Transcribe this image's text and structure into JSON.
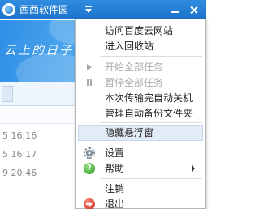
{
  "window": {
    "title": "西西软件园",
    "menu_icon": "dropdown-menu-icon",
    "minimize_icon": "minimize-icon",
    "close_icon": "close-icon"
  },
  "banner": {
    "slogan": "云上的日子"
  },
  "list": {
    "times": [
      "5 16:16",
      "5 16:17",
      "9 20:46"
    ]
  },
  "context_menu": {
    "items": [
      {
        "label": "访问百度云网站",
        "enabled": true
      },
      {
        "label": "进入回收站",
        "enabled": true
      },
      {
        "label": "开始全部任务",
        "enabled": false,
        "icon": "play-icon"
      },
      {
        "label": "暂停全部任务",
        "enabled": false,
        "icon": "pause-icon"
      },
      {
        "label": "本次传输完自动关机",
        "enabled": true
      },
      {
        "label": "管理自动备份文件夹",
        "enabled": true
      },
      {
        "label": "隐藏悬浮窗",
        "enabled": true,
        "highlighted": true
      },
      {
        "label": "设置",
        "enabled": true,
        "icon": "gear-icon"
      },
      {
        "label": "帮助",
        "enabled": true,
        "icon": "help-icon",
        "has_submenu": true
      },
      {
        "label": "注销",
        "enabled": true
      },
      {
        "label": "退出",
        "enabled": true,
        "icon": "exit-icon"
      }
    ]
  },
  "colors": {
    "titlebar": "#1d73cc",
    "banner": "#5db2f0",
    "menu_highlight": "#e3ecf6"
  }
}
